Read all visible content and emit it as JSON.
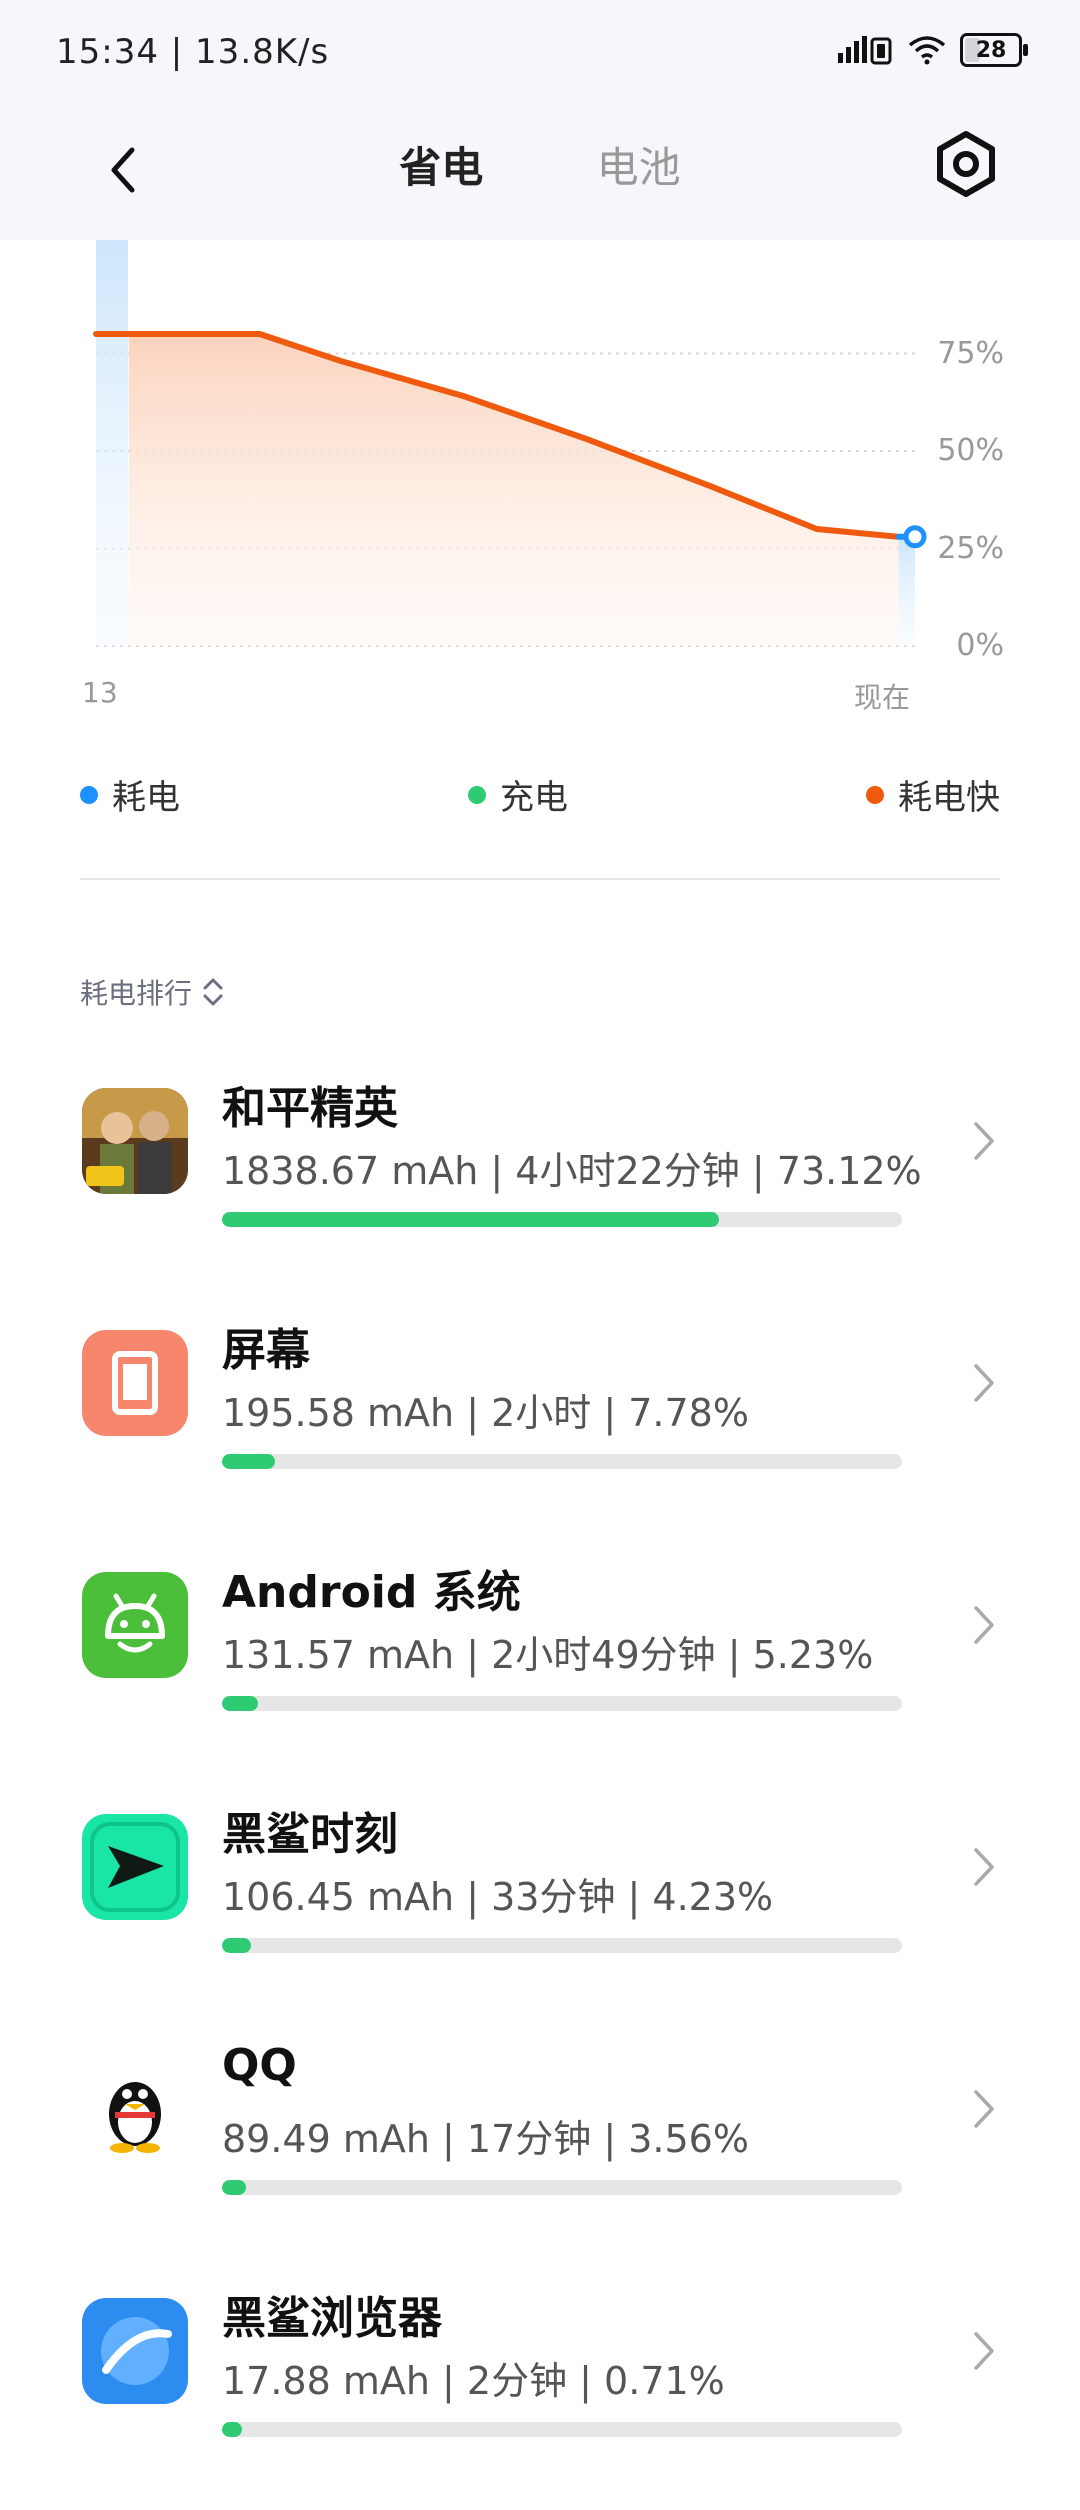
{
  "status": {
    "time_speed": "15:34 | 13.8K/s",
    "battery": "28"
  },
  "header": {
    "tabs": [
      {
        "label": "省电",
        "active": true
      },
      {
        "label": "电池",
        "active": false
      }
    ]
  },
  "chart_data": {
    "type": "area",
    "title": "",
    "xlabel": "",
    "ylabel": "",
    "yticks": [
      "75%",
      "50%",
      "25%",
      "0%"
    ],
    "xticks": [
      "13",
      "现在"
    ],
    "ylim": [
      0,
      100
    ],
    "series": [
      {
        "name": "耗电快",
        "color": "#f05a0e",
        "x": [
          0,
          0.2,
          0.3,
          0.45,
          0.6,
          0.75,
          0.88,
          0.98
        ],
        "values": [
          80,
          80,
          73,
          64,
          53,
          41,
          30,
          28
        ]
      },
      {
        "name": "耗电",
        "color": "#1e90ff",
        "x": [
          0.98,
          1.0
        ],
        "values": [
          28,
          28
        ]
      }
    ]
  },
  "legend": [
    {
      "label": "耗电",
      "color": "#1e90ff"
    },
    {
      "label": "充电",
      "color": "#2ecb72"
    },
    {
      "label": "耗电快",
      "color": "#f05a0e"
    }
  ],
  "ranking": {
    "label": "耗电排行",
    "apps": [
      {
        "name": "和平精英",
        "stats": "1838.67 mAh | 4小时22分钟 | 73.12%",
        "percent": 73.12,
        "icon": "game-peace-elite-icon"
      },
      {
        "name": "屏幕",
        "stats": "195.58 mAh | 2小时 | 7.78%",
        "percent": 7.78,
        "icon": "screen-icon"
      },
      {
        "name": "Android 系统",
        "stats": "131.57 mAh | 2小时49分钟 | 5.23%",
        "percent": 5.23,
        "icon": "android-icon"
      },
      {
        "name": "黑鲨时刻",
        "stats": "106.45 mAh | 33分钟 | 4.23%",
        "percent": 4.23,
        "icon": "blackshark-moment-icon"
      },
      {
        "name": "QQ",
        "stats": "89.49 mAh | 17分钟 | 3.56%",
        "percent": 3.56,
        "icon": "qq-penguin-icon"
      },
      {
        "name": "黑鲨浏览器",
        "stats": "17.88 mAh | 2分钟 | 0.71%",
        "percent": 0.71,
        "icon": "browser-icon"
      }
    ]
  }
}
